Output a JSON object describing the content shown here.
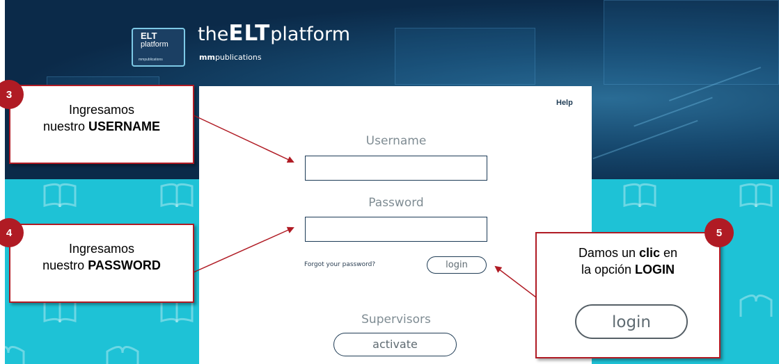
{
  "brand": {
    "badge_line1": "ELT",
    "badge_line2": "platform",
    "badge_publisher": "mmpublications",
    "title_the": "the",
    "title_elt": "ELT",
    "title_platform": "platform",
    "subtitle_bold": "mm",
    "subtitle_rest": "publications"
  },
  "login": {
    "help": "Help",
    "username_label": "Username",
    "username_value": "",
    "password_label": "Password",
    "password_value": "",
    "forgot": "Forgot your password?",
    "login_button": "login",
    "supervisors_label": "Supervisors",
    "activate_button": "activate"
  },
  "annotations": {
    "step3": {
      "number": "3",
      "line1": "Ingresamos",
      "line2_plain": "nuestro ",
      "line2_bold": "USERNAME"
    },
    "step4": {
      "number": "4",
      "line1": "Ingresamos",
      "line2_plain": "nuestro ",
      "line2_bold": "PASSWORD"
    },
    "step5": {
      "number": "5",
      "line1_plain": "Damos un ",
      "line1_bold": "clic",
      "line1_end": " en",
      "line2_plain": "la opción ",
      "line2_bold": "LOGIN",
      "button_example": "login"
    }
  },
  "colors": {
    "header_dark": "#0c2c4a",
    "teal_background": "#1ec2d6",
    "annotation_red": "#b01b24",
    "input_border": "#1b3a56"
  },
  "icons": {
    "background_pattern": "open-book-icon"
  }
}
